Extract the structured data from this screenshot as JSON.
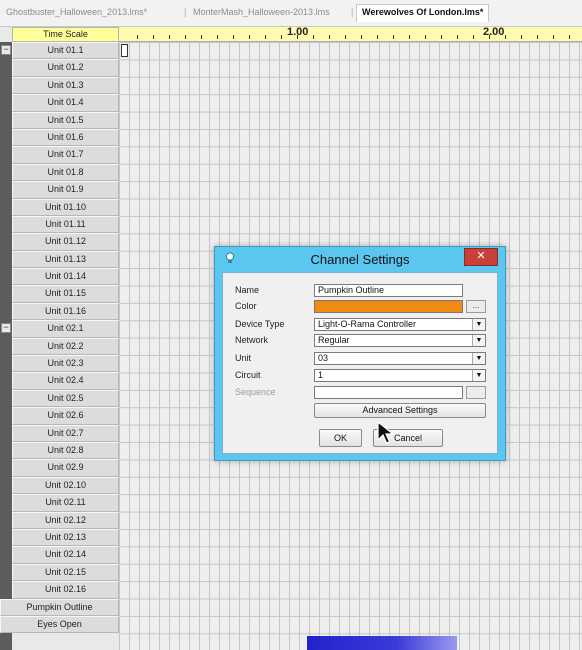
{
  "tabs": [
    {
      "label": "Ghostbuster_Halloween_2013.lms*",
      "active": false
    },
    {
      "label": "MonterMash_Halloween-2013.lms",
      "active": false
    },
    {
      "label": "Werewolves Of London.lms*",
      "active": true
    }
  ],
  "timeline": {
    "header": "Time Scale",
    "markers": [
      "1.00",
      "2.00"
    ]
  },
  "channels": [
    "Unit 01.1",
    "Unit 01.2",
    "Unit 01.3",
    "Unit 01.4",
    "Unit 01.5",
    "Unit 01.6",
    "Unit 01.7",
    "Unit 01.8",
    "Unit 01.9",
    "Unit 01.10",
    "Unit 01.11",
    "Unit 01.12",
    "Unit 01.13",
    "Unit 01.14",
    "Unit 01.15",
    "Unit 01.16",
    "Unit 02.1",
    "Unit 02.2",
    "Unit 02.3",
    "Unit 02.4",
    "Unit 02.5",
    "Unit 02.6",
    "Unit 02.7",
    "Unit 02.8",
    "Unit 02.9",
    "Unit 02.10",
    "Unit 02.11",
    "Unit 02.12",
    "Unit 02.13",
    "Unit 02.14",
    "Unit 02.15",
    "Unit 02.16",
    "Pumpkin Outline",
    "Eyes Open"
  ],
  "dialog": {
    "title": "Channel Settings",
    "close": "✕",
    "fields": {
      "name_label": "Name",
      "name_value": "Pumpkin Outline",
      "color_label": "Color",
      "color_value": "#f08a12",
      "device_label": "Device Type",
      "device_value": "Light-O-Rama Controller",
      "network_label": "Network",
      "network_value": "Regular",
      "unit_label": "Unit",
      "unit_value": "03",
      "circuit_label": "Circuit",
      "circuit_value": "1",
      "sequence_label": "Sequence",
      "sequence_value": ""
    },
    "buttons": {
      "advanced": "Advanced Settings",
      "ok": "OK",
      "cancel": "Cancel",
      "browse": "..."
    }
  },
  "colors": {
    "dialog_frame": "#5bc6ee",
    "close_button": "#c9403a",
    "time_header": "#ffff9a",
    "effect_bar": "#2222cc"
  }
}
